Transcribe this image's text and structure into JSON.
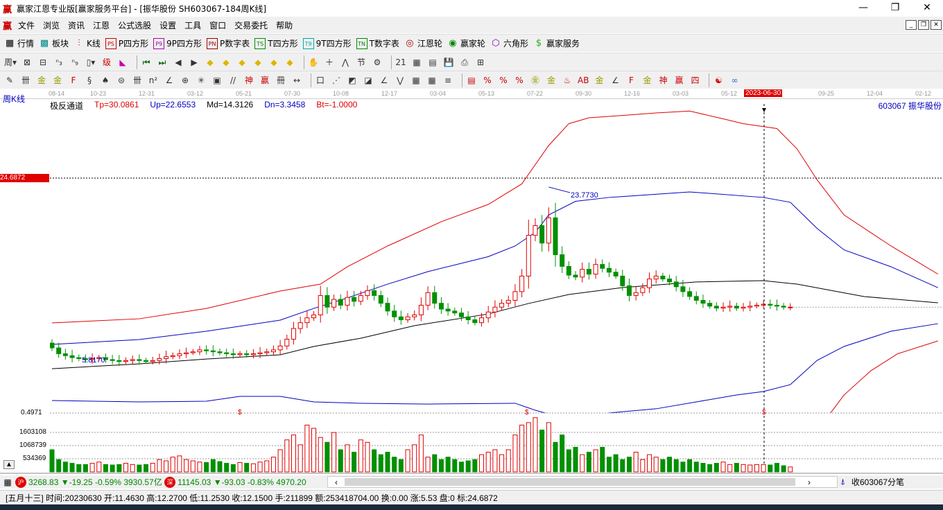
{
  "window": {
    "title": "赢家江恩专业版[赢家服务平台] - [振华股份  SH603067-184周K线]",
    "logo": "赢",
    "min": "—",
    "max": "❐",
    "close": "✕"
  },
  "menu": [
    "文件",
    "浏览",
    "资讯",
    "江恩",
    "公式选股",
    "设置",
    "工具",
    "窗口",
    "交易委托",
    "帮助"
  ],
  "mdi_buttons": [
    "_",
    "❐",
    "✕"
  ],
  "toolbar1": [
    {
      "icon": "grid-icon",
      "glyph": "▦",
      "label": "行情"
    },
    {
      "icon": "blocks-icon",
      "glyph": "▩",
      "label": "板块"
    },
    {
      "icon": "kline-icon",
      "glyph": "⫶",
      "label": "K线"
    },
    {
      "icon": "ps-icon",
      "glyph": "PS",
      "label": "P四方形"
    },
    {
      "icon": "p9-icon",
      "glyph": "P9",
      "label": "9P四方形"
    },
    {
      "icon": "pn-icon",
      "glyph": "PN",
      "label": "P数字表"
    },
    {
      "icon": "ts-icon",
      "glyph": "TS",
      "label": "T四方形"
    },
    {
      "icon": "t9-icon",
      "glyph": "T9",
      "label": "9T四方形"
    },
    {
      "icon": "tn-icon",
      "glyph": "TN",
      "label": "T数字表"
    },
    {
      "icon": "gann-wheel-icon",
      "glyph": "◎",
      "label": "江恩轮"
    },
    {
      "icon": "winner-wheel-icon",
      "glyph": "◉",
      "label": "赢家轮"
    },
    {
      "icon": "hexagon-icon",
      "glyph": "⬡",
      "label": "六角形"
    },
    {
      "icon": "dollar-icon",
      "glyph": "$",
      "label": "赢家服务"
    }
  ],
  "toolbar2": [
    "period-week-icon:周▾",
    "compare-icon:⊠",
    "doc-icon:⊟",
    "bars3-icon:ⁿ₃",
    "bars9-icon:ⁿ₉",
    "candle-type-icon:▯▾",
    "gann-icon:级",
    "color-bars-icon:◣",
    "first-icon:⏮",
    "last-icon:⏭",
    "left-icon:◀",
    "right-icon:▶",
    "diamond-left-icon:◆",
    "diamond-right-icon:◆",
    "diamond-expand-icon:◆",
    "diamond-shrink-icon:◆",
    "diamond-v-icon:◆",
    "diamond-all-icon:◆",
    "hand-icon:✋",
    "crosshair-icon:＋",
    "trend-icon:⋀",
    "node-icon:节",
    "tool-icon:⚙",
    "calendar-icon:21",
    "calculator-icon:▦",
    "notes-icon:▤",
    "save-icon:💾",
    "print-icon:⎙",
    "network-icon:⊞"
  ],
  "toolbar3": [
    "pen-icon:✎",
    "lines-icon:卌",
    "gold1-icon:金",
    "gold2-icon:金",
    "f-icon:F",
    "spiral-icon:§",
    "cone-icon:♠",
    "circle-icon:⊜",
    "ticks-icon:卌",
    "n2-icon:n²",
    "angle-icon:∠",
    "target-icon:⊕",
    "star-icon:✳",
    "square-icon:▣",
    "slash-icon://",
    "shen-icon:神",
    "ying-icon:赢",
    "comb-icon:冊",
    "ruler-icon:↔",
    "box-icon:口",
    "fan-icon:⋰",
    "fan2-icon:◩",
    "fan3-icon:◪",
    "angle2-icon:∠",
    "zigzag-icon:⋁",
    "grid1-icon:▦",
    "grid2-icon:▦",
    "parallel-icon:≡",
    "table-icon:▤",
    "pct1-icon:%",
    "pct2-icon:%",
    "pct3-icon:%",
    "gold3-icon:㊎",
    "gold4-icon:金",
    "fire-icon:♨",
    "ab-icon:AB",
    "gold5-icon:金",
    "fan4-icon:∠",
    "f2-icon:F",
    "jin-icon:金",
    "shen2-icon:神",
    "ying2-icon:赢",
    "si-icon:四",
    "taiji-icon:☯",
    "infinity-icon:∞"
  ],
  "chart": {
    "period_label": "周K线",
    "indicator_name": "极反通道",
    "tp": "Tp=30.0861",
    "up": "Up=22.6553",
    "md": "Md=14.3126",
    "dn": "Dn=3.3458",
    "bt": "Bt=-1.0000",
    "stock": "603067  振华股份",
    "cursor_price": "24.6872",
    "cursor_date": "2023-06-30",
    "peak_label": "23.7730",
    "low_label": "5.8170",
    "vol_bottom": "0.4971",
    "vol_ticks": [
      "1603108",
      "1068739",
      "534369"
    ],
    "marker": "$",
    "dates": [
      "08-14",
      "10-23",
      "12-31",
      "03-12",
      "05-21",
      "07-30",
      "10-08",
      "12-17",
      "03-04",
      "05-13",
      "07-22",
      "09-30",
      "12-16",
      "03-03",
      "05-12",
      "09-25",
      "12-04",
      "02-12"
    ]
  },
  "chart_data": {
    "type": "candlestick",
    "title": "SH603067-184周K线",
    "price_range": [
      0.4971,
      24.6872
    ],
    "closes": [
      7.2,
      6.6,
      6.4,
      6.2,
      6.1,
      6.0,
      6.1,
      6.2,
      6.0,
      5.9,
      5.8,
      5.9,
      6.0,
      5.9,
      5.8,
      5.9,
      6.1,
      6.3,
      6.4,
      6.6,
      6.7,
      6.8,
      7.0,
      6.9,
      6.8,
      6.7,
      6.6,
      6.5,
      6.6,
      6.5,
      6.6,
      6.7,
      6.8,
      7.0,
      7.4,
      8.1,
      9.2,
      9.8,
      10.3,
      10.6,
      12.6,
      11.4,
      12.2,
      11.6,
      12.4,
      12.0,
      12.6,
      13.1,
      12.6,
      11.8,
      11.0,
      10.4,
      10.1,
      10.4,
      10.6,
      11.6,
      12.9,
      11.8,
      11.2,
      11.0,
      10.8,
      10.4,
      10.1,
      9.8,
      10.3,
      10.9,
      11.4,
      11.8,
      12.1,
      13.0,
      14.6,
      18.8,
      19.8,
      18.0,
      20.6,
      16.8,
      15.6,
      14.7,
      14.5,
      15.3,
      14.8,
      15.8,
      15.4,
      15.0,
      14.6,
      13.6,
      12.6,
      12.9,
      13.4,
      14.3,
      14.6,
      14.3,
      14.0,
      13.5,
      13.0,
      12.5,
      12.1,
      11.8,
      11.5,
      11.3,
      11.4,
      11.5,
      11.3,
      11.4,
      11.5,
      11.6,
      11.7,
      11.6,
      11.5,
      11.4,
      11.4
    ],
    "volumes_k": [
      900,
      500,
      400,
      350,
      300,
      300,
      350,
      400,
      300,
      280,
      300,
      350,
      300,
      280,
      300,
      350,
      500,
      450,
      600,
      650,
      500,
      450,
      400,
      380,
      500,
      420,
      350,
      300,
      380,
      350,
      330,
      400,
      450,
      600,
      900,
      1300,
      1500,
      1100,
      1900,
      1770,
      1400,
      1200,
      1600,
      900,
      1100,
      800,
      1300,
      1200,
      900,
      700,
      800,
      600,
      500,
      900,
      1100,
      1500,
      600,
      700,
      500,
      600,
      500,
      400,
      450,
      500,
      700,
      800,
      900,
      700,
      900,
      1500,
      1900,
      2000,
      2200,
      1700,
      2000,
      1200,
      1500,
      900,
      1000,
      700,
      800,
      900,
      1000,
      600,
      700,
      500,
      600,
      800,
      500,
      700,
      600,
      500,
      600,
      500,
      400,
      500,
      400,
      350,
      300,
      350,
      400,
      300,
      350,
      300,
      280,
      300,
      300,
      280,
      350,
      250,
      200
    ],
    "indicators": [
      {
        "name": "Tp",
        "color": "#e00000",
        "points": [
          [
            0,
            9.78
          ],
          [
            13,
            10.2
          ],
          [
            23,
            11.27
          ],
          [
            34,
            13.06
          ],
          [
            40,
            13.77
          ],
          [
            44,
            15.56
          ],
          [
            50,
            17.7
          ],
          [
            58,
            20.2
          ],
          [
            65,
            21.98
          ],
          [
            70,
            24.1
          ],
          [
            74,
            28.05
          ],
          [
            77,
            30.3
          ],
          [
            80,
            30.9
          ],
          [
            90,
            31.4
          ],
          [
            95,
            31.6
          ],
          [
            100,
            30.8
          ],
          [
            103,
            30.3
          ],
          [
            108,
            29.8
          ],
          [
            111,
            27.7
          ],
          [
            114,
            24.5
          ],
          [
            118,
            20.9
          ],
          [
            125,
            17.7
          ],
          [
            132,
            14.8
          ]
        ]
      },
      {
        "name": "Up",
        "color": "#0000c0",
        "points": [
          [
            0,
            7.56
          ],
          [
            13,
            8.06
          ],
          [
            23,
            8.92
          ],
          [
            34,
            10.06
          ],
          [
            39,
            11.27
          ],
          [
            44,
            12.35
          ],
          [
            50,
            13.77
          ],
          [
            56,
            15.06
          ],
          [
            65,
            16.6
          ],
          [
            69,
            17.7
          ],
          [
            72,
            19.1
          ],
          [
            74,
            20.9
          ],
          [
            78,
            22.3
          ],
          [
            83,
            22.7
          ],
          [
            95,
            23.27
          ],
          [
            106,
            22.7
          ],
          [
            110,
            22.2
          ],
          [
            114,
            19.5
          ],
          [
            118,
            17.3
          ],
          [
            125,
            15.56
          ],
          [
            132,
            13.4
          ]
        ]
      },
      {
        "name": "Md",
        "color": "#000000",
        "points": [
          [
            0,
            5.06
          ],
          [
            13,
            5.56
          ],
          [
            23,
            6.06
          ],
          [
            34,
            6.49
          ],
          [
            39,
            7.35
          ],
          [
            46,
            8.2
          ],
          [
            54,
            9.49
          ],
          [
            65,
            10.7
          ],
          [
            71,
            11.78
          ],
          [
            77,
            12.7
          ],
          [
            85,
            13.42
          ],
          [
            96,
            14.0
          ],
          [
            106,
            14.13
          ],
          [
            111,
            13.77
          ],
          [
            121,
            12.49
          ],
          [
            132,
            11.85
          ]
        ]
      },
      {
        "name": "Dn",
        "color": "#0000c0",
        "points": [
          [
            0,
            1.78
          ],
          [
            13,
            1.64
          ],
          [
            23,
            1.71
          ],
          [
            28,
            2.21
          ],
          [
            34,
            2.21
          ],
          [
            39,
            1.64
          ],
          [
            46,
            1.5
          ],
          [
            56,
            1.42
          ],
          [
            69,
            1.5
          ],
          [
            72,
            0.78
          ],
          [
            75,
            0.2
          ],
          [
            79,
            0.07
          ],
          [
            83,
            0.5
          ],
          [
            90,
            0.93
          ],
          [
            96,
            1.64
          ],
          [
            102,
            2.35
          ],
          [
            106,
            2.71
          ],
          [
            110,
            3.42
          ],
          [
            114,
            5.92
          ],
          [
            118,
            7.35
          ],
          [
            125,
            8.92
          ],
          [
            132,
            9.7
          ]
        ]
      },
      {
        "name": "Bt",
        "color": "#e00000",
        "points": [
          [
            116,
            0.5
          ],
          [
            118,
            2.35
          ],
          [
            122,
            4.85
          ],
          [
            126,
            6.6
          ],
          [
            132,
            7.92
          ]
        ]
      }
    ]
  },
  "status": {
    "sh_badge": "沪",
    "sh": "3268.83",
    "sh_chg": "▼-19.25 -0.59% 3930.57亿",
    "sz_badge": "深",
    "sz": "11145.03",
    "sz_chg": "▼-93.03 -0.83% 4970.20",
    "scroll_left": "‹",
    "scroll_right": "›",
    "tick_label": "收603067分笔"
  },
  "info": "[五月十三] 时间:20230630 开:11.4630 高:12.2700 低:11.2530 收:12.1500 手:211899 额:253418704.00 换:0.00 涨:5.53 盘:0 标:24.6872",
  "colors": {
    "up": "#e00000",
    "down": "#009000",
    "cursor": "#e00000"
  }
}
